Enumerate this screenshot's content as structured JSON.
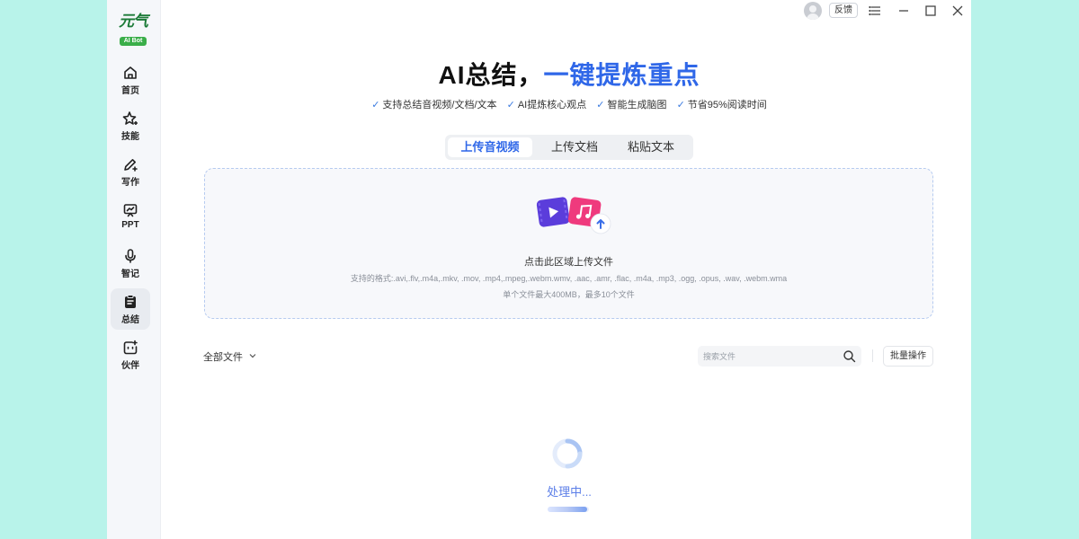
{
  "app": {
    "logo_text": "元气",
    "logo_badge": "AI Bot"
  },
  "sidebar": {
    "items": [
      {
        "label": "首页",
        "icon": "home-icon"
      },
      {
        "label": "技能",
        "icon": "sparkle-star-icon"
      },
      {
        "label": "写作",
        "icon": "pen-icon"
      },
      {
        "label": "PPT",
        "icon": "presentation-icon"
      },
      {
        "label": "智记",
        "icon": "microphone-icon"
      },
      {
        "label": "总结",
        "icon": "clipboard-summary-icon",
        "active": true
      },
      {
        "label": "伙伴",
        "icon": "bot-face-icon"
      }
    ]
  },
  "titlebar": {
    "feedback_label": "反馈"
  },
  "hero": {
    "title_part1": "AI总结，",
    "title_part2": "一键提炼重点",
    "accent_color": "#2f67e8",
    "features": [
      "支持总结音视频/文档/文本",
      "AI提炼核心观点",
      "智能生成脑图",
      "节省95%阅读时间"
    ]
  },
  "tabs": [
    {
      "label": "上传音视频",
      "active": true
    },
    {
      "label": "上传文档"
    },
    {
      "label": "粘贴文本"
    }
  ],
  "upload": {
    "hint": "点击此区域上传文件",
    "formats": "支持的格式:.avi,.flv,.m4a,.mkv, .mov, .mp4,.mpeg,.webm.wmv,  .aac, .amr, .flac, .m4a, .mp3, .ogg, .opus, .wav, .webm.wma",
    "limit": "单个文件最大400MB，最多10个文件"
  },
  "files": {
    "filter_label": "全部文件",
    "search_placeholder": "搜索文件",
    "batch_label": "批量操作"
  },
  "status": {
    "processing_text": "处理中...",
    "progress_percent": 95
  }
}
